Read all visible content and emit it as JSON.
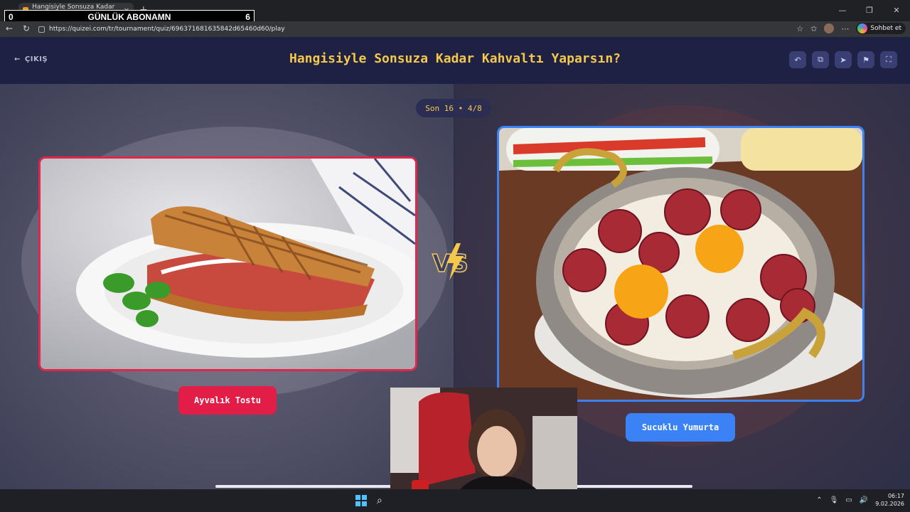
{
  "browser": {
    "tab_title": "Hangisiyle Sonsuza Kadar Kahvalt",
    "url": "https://quizei.com/tr/tournament/quiz/696371681635842d65460d60/play",
    "profile_button": "Sohbet et"
  },
  "stream_overlay": {
    "left_count": "0",
    "label": "GÜNLÜK ABONAMN",
    "right_count": "6"
  },
  "header": {
    "exit_label": "ÇIKIŞ",
    "title": "Hangisiyle Sonsuza Kadar Kahvaltı Yaparsın?"
  },
  "progress": "Son 16 • 4/8",
  "choices": {
    "left": {
      "label": "Ayvalık Tostu",
      "accent": "#e21d48"
    },
    "right": {
      "label": "Sucuklu Yumurta",
      "accent": "#3b82f6"
    }
  },
  "taskbar": {
    "time": "06:17",
    "date": "9.02.2026"
  },
  "colors": {
    "title": "#f4c84a",
    "header_bg": "#1e2044"
  }
}
